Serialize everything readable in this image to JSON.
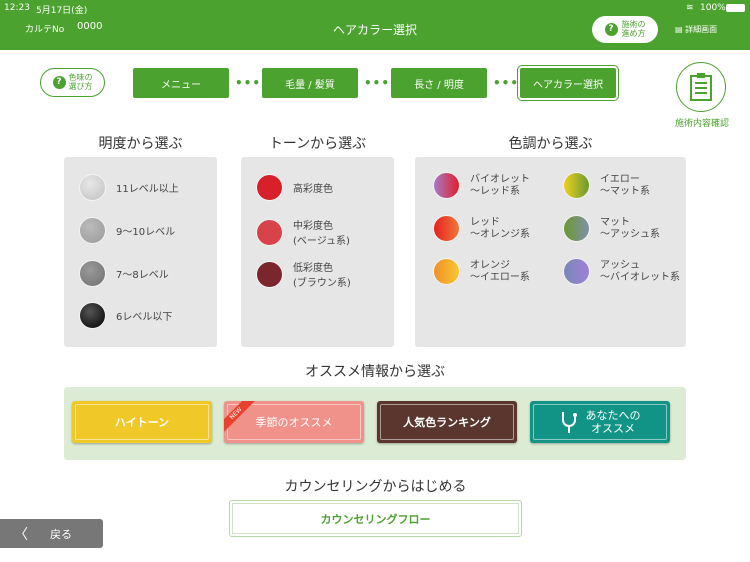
{
  "status": {
    "time": "12:23",
    "date": "5月17日(金)",
    "battery": "100%"
  },
  "header": {
    "karte_label": "カルテNo",
    "karte_no": "0000",
    "title": "ヘアカラー選択",
    "help_line1": "施術の",
    "help_line2": "進め方",
    "detail": "詳細画面"
  },
  "steps": {
    "help_line1": "色味の",
    "help_line2": "選び方",
    "items": [
      "メニュー",
      "毛量 / 髪質",
      "長さ / 明度",
      "ヘアカラー選択"
    ],
    "confirm": "施術内容確認"
  },
  "brightness": {
    "title": "明度から選ぶ",
    "items": [
      {
        "label": "11レベル以上",
        "color": "#cfcfcf"
      },
      {
        "label": "9〜10レベル",
        "color": "#a5a5a5"
      },
      {
        "label": "7〜8レベル",
        "color": "#7c7c7c"
      },
      {
        "label": "6レベル以下",
        "color": "#1a1a1a"
      }
    ]
  },
  "tone": {
    "title": "トーンから選ぶ",
    "items": [
      {
        "l1": "高彩度色",
        "l2": "",
        "color": "#d8202a"
      },
      {
        "l1": "中彩度色",
        "l2": "(ベージュ系)",
        "color": "#d8434a"
      },
      {
        "l1": "低彩度色",
        "l2": "(ブラウン系)",
        "color": "#7a262c"
      }
    ]
  },
  "hue": {
    "title": "色調から選ぶ",
    "items": [
      {
        "l1": "バイオレット",
        "l2": "〜レッド系",
        "c1": "#a67ac8",
        "c2": "#e0202a"
      },
      {
        "l1": "イエロー",
        "l2": "〜マット系",
        "c1": "#f0d020",
        "c2": "#6a9a30"
      },
      {
        "l1": "レッド",
        "l2": "〜オレンジ系",
        "c1": "#e82020",
        "c2": "#f07838"
      },
      {
        "l1": "マット",
        "l2": "〜アッシュ系",
        "c1": "#6a9a30",
        "c2": "#8090a8"
      },
      {
        "l1": "オレンジ",
        "l2": "〜イエロー系",
        "c1": "#f0902a",
        "c2": "#f8c830"
      },
      {
        "l1": "アッシュ",
        "l2": "〜バイオレット系",
        "c1": "#7888b8",
        "c2": "#a080d8"
      }
    ]
  },
  "recommend": {
    "title": "オススメ情報から選ぶ",
    "high_tone": "ハイトーン",
    "seasonal": "季節のオススメ",
    "new_badge": "NEW",
    "ranking": "人気色ランキング",
    "for_you_1": "あなたへの",
    "for_you_2": "オススメ"
  },
  "counseling": {
    "title": "カウンセリングからはじめる",
    "button": "カウンセリングフロー"
  },
  "back": "戻る"
}
